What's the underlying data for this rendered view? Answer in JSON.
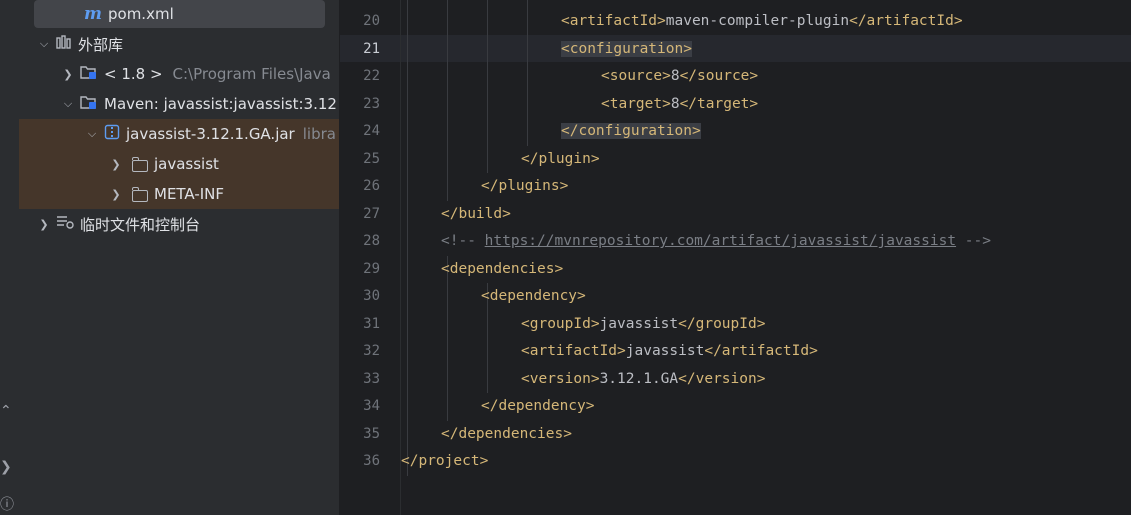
{
  "project_tree": {
    "pom_file": "pom.xml",
    "external_libraries": "外部库",
    "jdk": {
      "label": "< 1.8 >",
      "path": "C:\\Program Files\\Java"
    },
    "maven_lib": "Maven: javassist:javassist:3.12",
    "jar": {
      "name": "javassist-3.12.1.GA.jar",
      "suffix": "libra"
    },
    "folders": [
      "javassist",
      "META-INF"
    ],
    "scratches": "临时文件和控制台"
  },
  "editor": {
    "current_line": "21",
    "lines": [
      {
        "num": "20",
        "indent": 4,
        "parts": [
          {
            "t": "tag",
            "v": "<artifactId>"
          },
          {
            "t": "txt",
            "v": "maven-compiler-plugin"
          },
          {
            "t": "tag",
            "v": "</artifactId>"
          }
        ]
      },
      {
        "num": "21",
        "indent": 4,
        "parts": [
          {
            "t": "tag-hl",
            "v": "<configuration>"
          }
        ]
      },
      {
        "num": "22",
        "indent": 5,
        "parts": [
          {
            "t": "tag",
            "v": "<source>"
          },
          {
            "t": "txt",
            "v": "8"
          },
          {
            "t": "tag",
            "v": "</source>"
          }
        ]
      },
      {
        "num": "23",
        "indent": 5,
        "parts": [
          {
            "t": "tag",
            "v": "<target>"
          },
          {
            "t": "txt",
            "v": "8"
          },
          {
            "t": "tag",
            "v": "</target>"
          }
        ]
      },
      {
        "num": "24",
        "indent": 4,
        "parts": [
          {
            "t": "tag-hl",
            "v": "</configuration>"
          }
        ]
      },
      {
        "num": "25",
        "indent": 3,
        "parts": [
          {
            "t": "tag",
            "v": "</plugin>"
          }
        ]
      },
      {
        "num": "26",
        "indent": 2,
        "parts": [
          {
            "t": "tag",
            "v": "</plugins>"
          }
        ]
      },
      {
        "num": "27",
        "indent": 1,
        "parts": [
          {
            "t": "tag",
            "v": "</build>"
          }
        ]
      },
      {
        "num": "28",
        "indent": 1,
        "parts": [
          {
            "t": "cmt",
            "v": "<!-- "
          },
          {
            "t": "link",
            "v": "https://mvnrepository.com/artifact/javassist/javassist"
          },
          {
            "t": "cmt",
            "v": " -->"
          }
        ]
      },
      {
        "num": "29",
        "indent": 1,
        "parts": [
          {
            "t": "tag",
            "v": "<dependencies>"
          }
        ]
      },
      {
        "num": "30",
        "indent": 2,
        "parts": [
          {
            "t": "tag",
            "v": "<dependency>"
          }
        ]
      },
      {
        "num": "31",
        "indent": 3,
        "parts": [
          {
            "t": "tag",
            "v": "<groupId>"
          },
          {
            "t": "txt",
            "v": "javassist"
          },
          {
            "t": "tag",
            "v": "</groupId>"
          }
        ]
      },
      {
        "num": "32",
        "indent": 3,
        "parts": [
          {
            "t": "tag",
            "v": "<artifactId>"
          },
          {
            "t": "txt",
            "v": "javassist"
          },
          {
            "t": "tag",
            "v": "</artifactId>"
          }
        ]
      },
      {
        "num": "33",
        "indent": 3,
        "parts": [
          {
            "t": "tag",
            "v": "<version>"
          },
          {
            "t": "txt",
            "v": "3.12.1.GA"
          },
          {
            "t": "tag",
            "v": "</version>"
          }
        ]
      },
      {
        "num": "34",
        "indent": 2,
        "parts": [
          {
            "t": "tag",
            "v": "</dependency>"
          }
        ]
      },
      {
        "num": "35",
        "indent": 1,
        "parts": [
          {
            "t": "tag",
            "v": "</dependencies>"
          }
        ]
      },
      {
        "num": "36",
        "indent": 0,
        "parts": [
          {
            "t": "tag",
            "v": "</project>"
          }
        ]
      }
    ]
  }
}
